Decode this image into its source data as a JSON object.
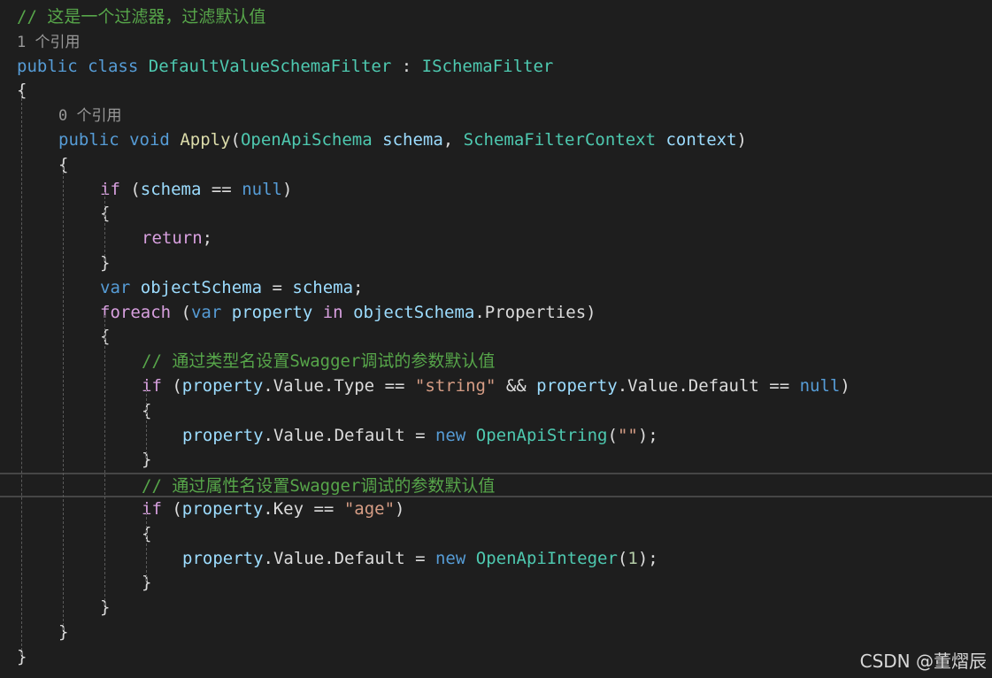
{
  "colors": {
    "background": "#1e1e1e",
    "keyword": "#569cd6",
    "control_keyword": "#d8a0df",
    "type": "#4ec9b0",
    "method": "#dcdcaa",
    "parameter": "#9cdcfe",
    "string": "#d69d85",
    "comment": "#57a64a",
    "codelens": "#999999"
  },
  "editor": {
    "current_line_index": 19,
    "lines": [
      {
        "tokens": [
          {
            "c": "cmt",
            "v": "// 这是一个过滤器，过滤默认值"
          }
        ]
      },
      {
        "tokens": [
          {
            "c": "lens",
            "v": "1 个引用"
          }
        ]
      },
      {
        "tokens": [
          {
            "c": "kw",
            "v": "public"
          },
          {
            "c": "plain",
            "v": " "
          },
          {
            "c": "kw",
            "v": "class"
          },
          {
            "c": "plain",
            "v": " "
          },
          {
            "c": "type",
            "v": "DefaultValueSchemaFilter"
          },
          {
            "c": "plain",
            "v": " : "
          },
          {
            "c": "type",
            "v": "ISchemaFilter"
          }
        ]
      },
      {
        "tokens": [
          {
            "c": "plain",
            "v": "{"
          }
        ]
      },
      {
        "tokens": [
          {
            "c": "lens",
            "v": "0 个引用"
          }
        ]
      },
      {
        "tokens": [
          {
            "c": "kw",
            "v": "public"
          },
          {
            "c": "plain",
            "v": " "
          },
          {
            "c": "kw",
            "v": "void"
          },
          {
            "c": "plain",
            "v": " "
          },
          {
            "c": "method",
            "v": "Apply"
          },
          {
            "c": "plain",
            "v": "("
          },
          {
            "c": "type",
            "v": "OpenApiSchema"
          },
          {
            "c": "plain",
            "v": " "
          },
          {
            "c": "param",
            "v": "schema"
          },
          {
            "c": "plain",
            "v": ", "
          },
          {
            "c": "type",
            "v": "SchemaFilterContext"
          },
          {
            "c": "plain",
            "v": " "
          },
          {
            "c": "param",
            "v": "context"
          },
          {
            "c": "plain",
            "v": ")"
          }
        ]
      },
      {
        "tokens": [
          {
            "c": "plain",
            "v": "{"
          }
        ]
      },
      {
        "tokens": [
          {
            "c": "ctl",
            "v": "if"
          },
          {
            "c": "plain",
            "v": " ("
          },
          {
            "c": "param",
            "v": "schema"
          },
          {
            "c": "plain",
            "v": " == "
          },
          {
            "c": "kw",
            "v": "null"
          },
          {
            "c": "plain",
            "v": ")"
          }
        ]
      },
      {
        "tokens": [
          {
            "c": "plain",
            "v": "{"
          }
        ]
      },
      {
        "tokens": [
          {
            "c": "ctl",
            "v": "return"
          },
          {
            "c": "plain",
            "v": ";"
          }
        ]
      },
      {
        "tokens": [
          {
            "c": "plain",
            "v": "}"
          }
        ]
      },
      {
        "tokens": [
          {
            "c": "kw",
            "v": "var"
          },
          {
            "c": "plain",
            "v": " "
          },
          {
            "c": "param",
            "v": "objectSchema"
          },
          {
            "c": "plain",
            "v": " = "
          },
          {
            "c": "param",
            "v": "schema"
          },
          {
            "c": "plain",
            "v": ";"
          }
        ]
      },
      {
        "tokens": [
          {
            "c": "ctl",
            "v": "foreach"
          },
          {
            "c": "plain",
            "v": " ("
          },
          {
            "c": "kw",
            "v": "var"
          },
          {
            "c": "plain",
            "v": " "
          },
          {
            "c": "param",
            "v": "property"
          },
          {
            "c": "plain",
            "v": " "
          },
          {
            "c": "ctl",
            "v": "in"
          },
          {
            "c": "plain",
            "v": " "
          },
          {
            "c": "param",
            "v": "objectSchema"
          },
          {
            "c": "plain",
            "v": ".Properties)"
          }
        ]
      },
      {
        "tokens": [
          {
            "c": "plain",
            "v": "{"
          }
        ]
      },
      {
        "tokens": [
          {
            "c": "cmt",
            "v": "// 通过类型名设置Swagger调试的参数默认值"
          }
        ]
      },
      {
        "tokens": [
          {
            "c": "ctl",
            "v": "if"
          },
          {
            "c": "plain",
            "v": " ("
          },
          {
            "c": "param",
            "v": "property"
          },
          {
            "c": "plain",
            "v": ".Value.Type == "
          },
          {
            "c": "str",
            "v": "\"string\""
          },
          {
            "c": "plain",
            "v": " && "
          },
          {
            "c": "param",
            "v": "property"
          },
          {
            "c": "plain",
            "v": ".Value.Default == "
          },
          {
            "c": "kw",
            "v": "null"
          },
          {
            "c": "plain",
            "v": ")"
          }
        ]
      },
      {
        "tokens": [
          {
            "c": "plain",
            "v": "{"
          }
        ]
      },
      {
        "tokens": [
          {
            "c": "param",
            "v": "property"
          },
          {
            "c": "plain",
            "v": ".Value.Default = "
          },
          {
            "c": "kw",
            "v": "new"
          },
          {
            "c": "plain",
            "v": " "
          },
          {
            "c": "type",
            "v": "OpenApiString"
          },
          {
            "c": "plain",
            "v": "("
          },
          {
            "c": "str",
            "v": "\"\""
          },
          {
            "c": "plain",
            "v": ");"
          }
        ]
      },
      {
        "tokens": [
          {
            "c": "plain",
            "v": "}"
          }
        ]
      },
      {
        "tokens": [
          {
            "c": "cmt",
            "v": "// 通过属性名设置Swagger调试的参数默认值"
          }
        ]
      },
      {
        "tokens": [
          {
            "c": "ctl",
            "v": "if"
          },
          {
            "c": "plain",
            "v": " ("
          },
          {
            "c": "param",
            "v": "property"
          },
          {
            "c": "plain",
            "v": ".Key == "
          },
          {
            "c": "str",
            "v": "\"age\""
          },
          {
            "c": "plain",
            "v": ")"
          }
        ]
      },
      {
        "tokens": [
          {
            "c": "plain",
            "v": "{"
          }
        ]
      },
      {
        "tokens": [
          {
            "c": "param",
            "v": "property"
          },
          {
            "c": "plain",
            "v": ".Value.Default = "
          },
          {
            "c": "kw",
            "v": "new"
          },
          {
            "c": "plain",
            "v": " "
          },
          {
            "c": "type",
            "v": "OpenApiInteger"
          },
          {
            "c": "plain",
            "v": "("
          },
          {
            "c": "num",
            "v": "1"
          },
          {
            "c": "plain",
            "v": ");"
          }
        ]
      },
      {
        "tokens": [
          {
            "c": "plain",
            "v": "}"
          }
        ]
      },
      {
        "tokens": [
          {
            "c": "plain",
            "v": "}"
          }
        ]
      },
      {
        "tokens": [
          {
            "c": "plain",
            "v": "}"
          }
        ]
      },
      {
        "tokens": [
          {
            "c": "plain",
            "v": "}"
          }
        ]
      }
    ]
  },
  "watermark": "CSDN @董熠辰"
}
